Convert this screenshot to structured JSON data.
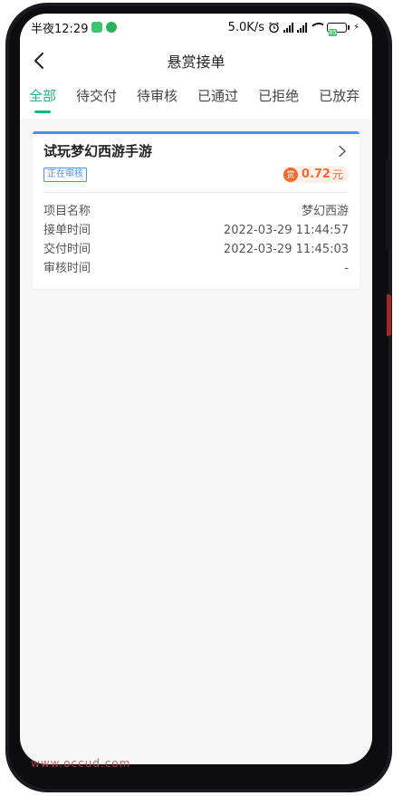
{
  "status_bar": {
    "time": "半夜12:29",
    "net_speed": "5.0K/s",
    "battery_level": "85"
  },
  "nav": {
    "title": "悬赏接单"
  },
  "tabs": [
    {
      "label": "全部",
      "active": true
    },
    {
      "label": "待交付",
      "active": false
    },
    {
      "label": "待审核",
      "active": false
    },
    {
      "label": "已通过",
      "active": false
    },
    {
      "label": "已拒绝",
      "active": false
    },
    {
      "label": "已放弃",
      "active": false
    }
  ],
  "order": {
    "title": "试玩梦幻西游手游",
    "status": "正在审核",
    "reward_icon_text": "赏",
    "reward_amount": "0.72",
    "reward_unit": "元",
    "rows": [
      {
        "label": "项目名称",
        "value": "梦幻西游"
      },
      {
        "label": "接单时间",
        "value": "2022-03-29 11:44:57"
      },
      {
        "label": "交付时间",
        "value": "2022-03-29 11:45:03"
      },
      {
        "label": "审核时间",
        "value": "-"
      }
    ]
  },
  "watermark": "www.occud.com",
  "colors": {
    "accent": "#1db38a",
    "card_border": "#4a8ef0",
    "reward": "#f26b2f"
  }
}
